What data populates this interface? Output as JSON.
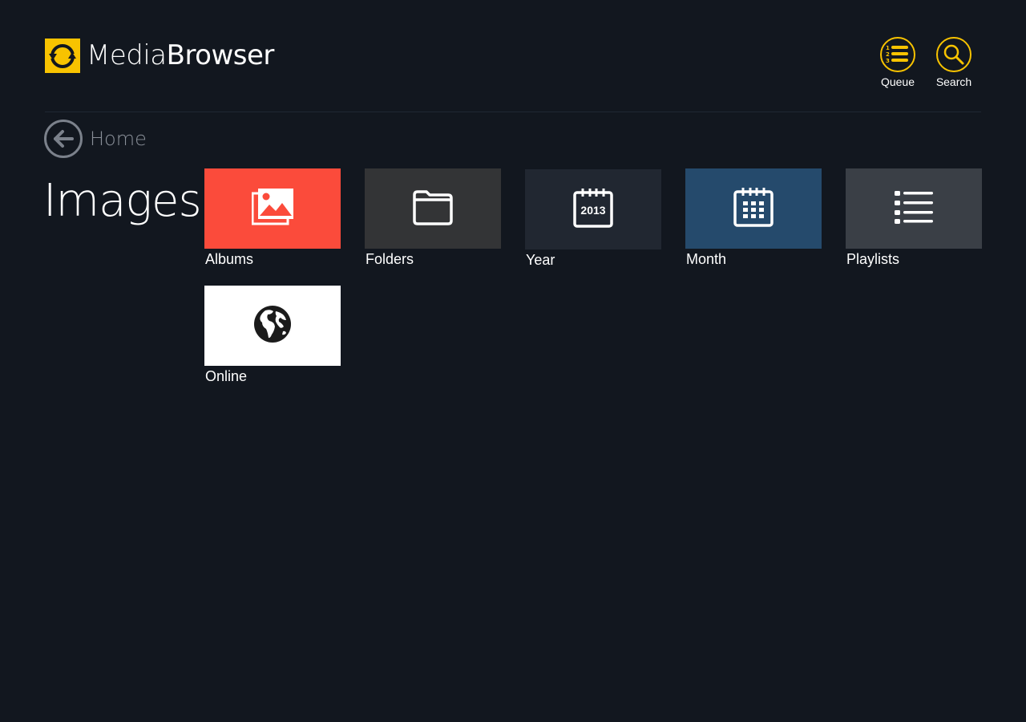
{
  "app": {
    "brand_light": "Media",
    "brand_bold": "Browser",
    "logo_icon": "sync-arrows-icon",
    "accent_color": "#f8c300"
  },
  "header": {
    "actions": [
      {
        "label": "Queue",
        "icon": "queue-list-icon"
      },
      {
        "label": "Search",
        "icon": "search-icon"
      }
    ]
  },
  "breadcrumb": {
    "label": "Home",
    "icon": "back-arrow-icon"
  },
  "page": {
    "title": "Images"
  },
  "tiles": [
    {
      "label": "Albums",
      "icon": "albums-icon",
      "color": "#fb4b3b"
    },
    {
      "label": "Folders",
      "icon": "folder-icon",
      "color": "#333436"
    },
    {
      "label": "Year",
      "icon": "calendar-year-icon",
      "icon_text": "2013",
      "color": "#212731"
    },
    {
      "label": "Month",
      "icon": "calendar-month-icon",
      "color": "#254a6c"
    },
    {
      "label": "Playlists",
      "icon": "playlist-icon",
      "color": "#3a3f46"
    },
    {
      "label": "Online",
      "icon": "globe-icon",
      "color": "#ffffff"
    }
  ]
}
